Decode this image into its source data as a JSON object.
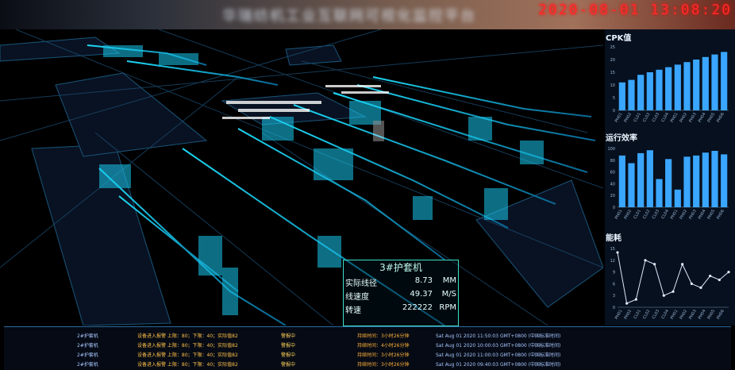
{
  "header": {
    "title": "华瑞纺机工业互联网可视化监控平台",
    "datetime": "2020-08-01 13:08:20"
  },
  "popup": {
    "title": "3#护套机",
    "rows": [
      {
        "label": "实际线径",
        "value": "8.73",
        "unit": "MM"
      },
      {
        "label": "线速度",
        "value": "49.37",
        "unit": "M/S"
      },
      {
        "label": "转速",
        "value": "222222",
        "unit": "RPM"
      }
    ]
  },
  "panels": {
    "cpk": {
      "title": "CPK值"
    },
    "efficiency": {
      "title": "运行效率"
    },
    "energy": {
      "title": "能耗"
    }
  },
  "chart_data": [
    {
      "type": "bar",
      "title": "CPK值",
      "categories": [
        "PH01",
        "PH02",
        "CL01",
        "CL02",
        "CL03",
        "CL04",
        "PH01",
        "PH02",
        "PH03",
        "PH04",
        "PH05",
        "PH06"
      ],
      "values": [
        11,
        12,
        14,
        15,
        16,
        17,
        18,
        19,
        20,
        21,
        22,
        23
      ],
      "ylim": [
        0,
        25
      ],
      "yticks": [
        0,
        5,
        10,
        15,
        20,
        25
      ],
      "color": "#3aa6ff"
    },
    {
      "type": "bar",
      "title": "运行效率",
      "categories": [
        "PH01",
        "PH02",
        "CL01",
        "CL02",
        "CL03",
        "CL04",
        "PH01",
        "PH02",
        "PH03",
        "PH04",
        "PH05",
        "PH06"
      ],
      "values": [
        88,
        75,
        92,
        97,
        48,
        82,
        30,
        86,
        88,
        93,
        96,
        90
      ],
      "ylim": [
        0,
        100
      ],
      "yticks": [
        0,
        20,
        40,
        60,
        80,
        100
      ],
      "color": "#3aa6ff"
    },
    {
      "type": "line",
      "title": "能耗",
      "categories": [
        "PH01",
        "PH02",
        "CL01",
        "CL02",
        "CL03",
        "CL04",
        "PH01",
        "PH02",
        "PH03",
        "PH04",
        "PH05",
        "PH06"
      ],
      "values": [
        14,
        1,
        2,
        12,
        11,
        3,
        4,
        11,
        6,
        5,
        8,
        7,
        9
      ],
      "ylim": [
        0,
        15
      ],
      "yticks": [
        0,
        3,
        6,
        9,
        12,
        15
      ],
      "color": "#dfe9ff"
    }
  ],
  "alarms": [
    {
      "device": "2#护套机",
      "message": "设备进入报警 上限：80；下限：40；实际值82",
      "status": "警报中",
      "duration": "持续时间：3小时26分钟",
      "time": "Sat Aug 01 2020 11:50:03 GMT+0800 (中国标准时间)"
    },
    {
      "device": "2#护套机",
      "message": "设备进入报警 上限：80；下限：40；实际值82",
      "status": "警报中",
      "duration": "持续时间：4小时26分钟",
      "time": "Sat Aug 01 2020 10:00:03 GMT+0800 (中国标准时间)"
    },
    {
      "device": "2#护套机",
      "message": "设备进入报警 上限：80；下限：40；实际值82",
      "status": "警报中",
      "duration": "持续时间：3小时26分钟",
      "time": "Sat Aug 01 2020 11:00:03 GMT+0800 (中国标准时间)"
    },
    {
      "device": "2#护套机",
      "message": "设备进入报警 上限：80；下限：40；实际值82",
      "status": "警报中",
      "duration": "持续时间：3小时26分钟",
      "time": "Sat Aug 01 2020 09:40:03 GMT+0800 (中国标准时间)"
    }
  ]
}
